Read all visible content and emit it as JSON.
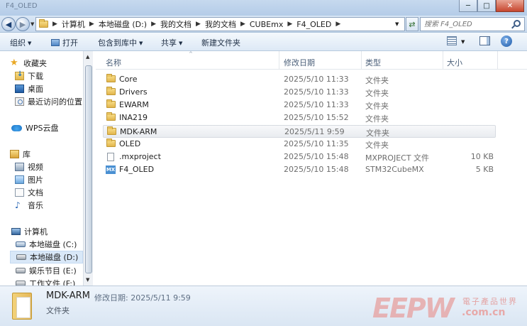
{
  "window": {
    "title": "F4_OLED",
    "buttons": {
      "minimize": "─",
      "maximize": "□",
      "close": "✕"
    }
  },
  "nav": {
    "back": "◀",
    "forward": "▶",
    "refresh": "⇄"
  },
  "address": {
    "crumbs": [
      "计算机",
      "本地磁盘 (D:)",
      "我的文档",
      "我的文档",
      "CUBEmx",
      "F4_OLED"
    ]
  },
  "search": {
    "placeholder": "搜索 F4_OLED"
  },
  "toolbar": {
    "organize": "组织",
    "open": "打开",
    "include_in_library": "包含到库中",
    "share": "共享",
    "new_folder": "新建文件夹",
    "help": "?"
  },
  "sidebar": {
    "favorites": "收藏夹",
    "downloads": "下载",
    "desktop": "桌面",
    "recent": "最近访问的位置",
    "wps": "WPS云盘",
    "libraries": "库",
    "videos": "视频",
    "pictures": "图片",
    "documents": "文档",
    "music": "音乐",
    "computer": "计算机",
    "drive_c": "本地磁盘 (C:)",
    "drive_d": "本地磁盘 (D:)",
    "drive_e": "娱乐节目 (E:)",
    "drive_f": "工作文件 (F:)"
  },
  "columns": {
    "name": "名称",
    "date": "修改日期",
    "type": "类型",
    "size": "大小"
  },
  "files": [
    {
      "name": "Core",
      "date": "2025/5/10 11:33",
      "type": "文件夹",
      "size": "",
      "icon": "folder-icon"
    },
    {
      "name": "Drivers",
      "date": "2025/5/10 11:33",
      "type": "文件夹",
      "size": "",
      "icon": "folder-icon"
    },
    {
      "name": "EWARM",
      "date": "2025/5/10 11:33",
      "type": "文件夹",
      "size": "",
      "icon": "folder-icon"
    },
    {
      "name": "INA219",
      "date": "2025/5/10 15:52",
      "type": "文件夹",
      "size": "",
      "icon": "folder-icon"
    },
    {
      "name": "MDK-ARM",
      "date": "2025/5/11 9:59",
      "type": "文件夹",
      "size": "",
      "icon": "folder-icon"
    },
    {
      "name": "OLED",
      "date": "2025/5/10 11:35",
      "type": "文件夹",
      "size": "",
      "icon": "folder-icon"
    },
    {
      "name": ".mxproject",
      "date": "2025/5/10 15:48",
      "type": "MXPROJECT 文件",
      "size": "10 KB",
      "icon": "file-icon"
    },
    {
      "name": "F4_OLED",
      "date": "2025/5/10 15:48",
      "type": "STM32CubeMX",
      "size": "5 KB",
      "icon": "mx-icon"
    }
  ],
  "details": {
    "name": "MDK-ARM",
    "meta": "修改日期: 2025/5/11 9:59",
    "type": "文件夹"
  },
  "watermark": {
    "logo": "EEPW",
    "text": "電子產品世界",
    "url": ".com.cn"
  }
}
